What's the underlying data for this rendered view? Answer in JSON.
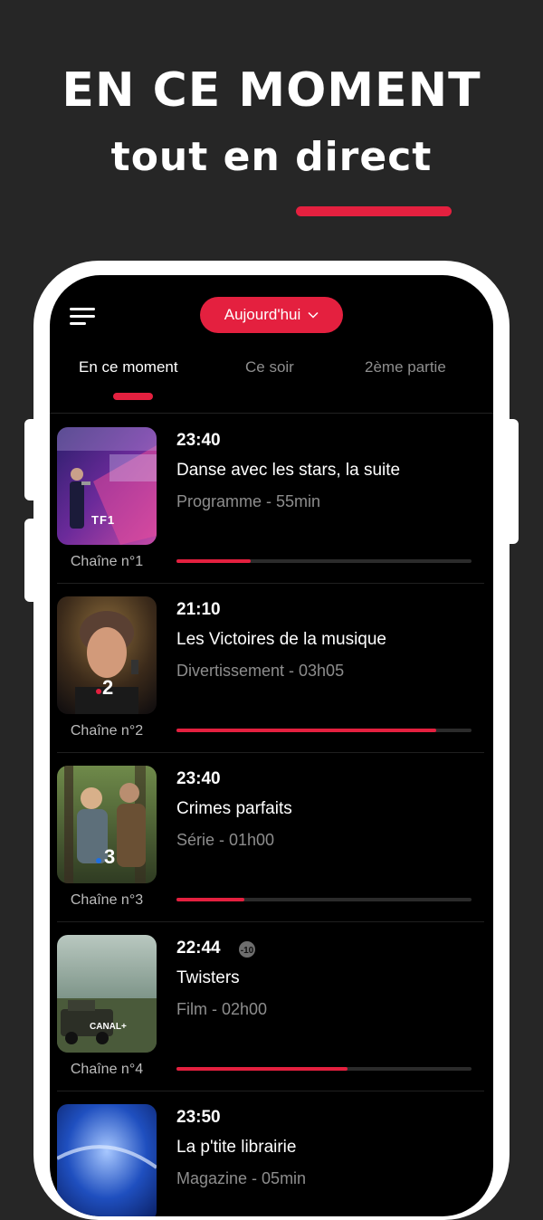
{
  "promo": {
    "headline": "EN CE MOMENT",
    "subheadline": "tout en direct",
    "accent_color": "#e4203f"
  },
  "app": {
    "menu_icon": "hamburger-menu-icon",
    "date_selector": {
      "label": "Aujourd'hui",
      "icon": "chevron-down-icon"
    },
    "tabs": [
      {
        "label": "En ce moment",
        "active": true
      },
      {
        "label": "Ce soir",
        "active": false
      },
      {
        "label": "2ème partie",
        "active": false
      }
    ],
    "programs": [
      {
        "time": "23:40",
        "title": "Danse avec les stars, la suite",
        "meta": "Programme - 55min",
        "channel": "Chaîne n°1",
        "logo": "TF1",
        "progress": 0.25,
        "rating": ""
      },
      {
        "time": "21:10",
        "title": "Les Victoires de la musique",
        "meta": "Divertissement - 03h05",
        "channel": "Chaîne n°2",
        "logo": "2",
        "progress": 0.88,
        "rating": ""
      },
      {
        "time": "23:40",
        "title": "Crimes parfaits",
        "meta": "Série - 01h00",
        "channel": "Chaîne n°3",
        "logo": "3",
        "progress": 0.23,
        "rating": ""
      },
      {
        "time": "22:44",
        "title": "Twisters",
        "meta": "Film - 02h00",
        "channel": "Chaîne n°4",
        "logo": "CANAL+",
        "progress": 0.58,
        "rating": "-10"
      },
      {
        "time": "23:50",
        "title": "La p'tite librairie",
        "meta": "Magazine - 05min",
        "channel": "",
        "logo": "",
        "progress": 0,
        "rating": ""
      }
    ]
  }
}
